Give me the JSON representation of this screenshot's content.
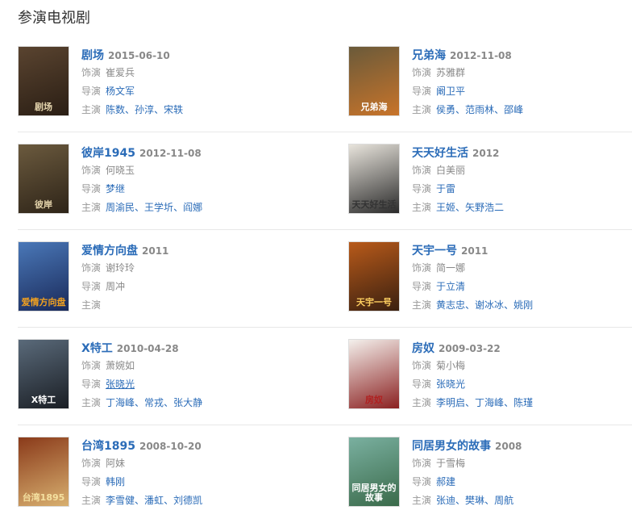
{
  "section": {
    "title": "参演电视剧"
  },
  "labels": {
    "role": "饰演",
    "director": "导演",
    "cast": "主演"
  },
  "colors": {
    "link": "#2b6cb8",
    "muted": "#888888",
    "divider": "#e8e8e8"
  },
  "dramas": [
    {
      "title": "剧场",
      "year": "2015-06-10",
      "role": "崔爱兵",
      "director": "杨文军",
      "director_link": true,
      "cast": [
        "陈数",
        "孙淳",
        "宋轶"
      ],
      "poster": {
        "colors": [
          "#5a4430",
          "#2a1e14"
        ],
        "text": "剧场",
        "text_color": "#e8d8b0"
      }
    },
    {
      "title": "兄弟海",
      "year": "2012-11-08",
      "role": "苏雅群",
      "director": "阚卫平",
      "director_link": true,
      "cast": [
        "侯勇",
        "范雨林",
        "邵峰"
      ],
      "poster": {
        "colors": [
          "#6a5a3a",
          "#c8742a"
        ],
        "text": "兄弟海",
        "text_color": "#ffffff"
      }
    },
    {
      "title": "彼岸1945",
      "year": "2012-11-08",
      "role": "何晓玉",
      "director": "梦继",
      "director_link": true,
      "cast": [
        "周渝民",
        "王学圻",
        "阎娜"
      ],
      "poster": {
        "colors": [
          "#6b5a3e",
          "#2e2418"
        ],
        "text": "彼岸",
        "text_color": "#e0d0a8"
      }
    },
    {
      "title": "天天好生活",
      "year": "2012",
      "role": "白美丽",
      "director": "于雷",
      "director_link": true,
      "cast": [
        "王姬",
        "矢野浩二"
      ],
      "poster": {
        "colors": [
          "#e8e4dc",
          "#2a2a2a"
        ],
        "text": "天天好生活",
        "text_color": "#333333"
      }
    },
    {
      "title": "爱情方向盘",
      "year": "2011",
      "role": "谢玲玲",
      "director": "周冲",
      "director_link": false,
      "cast": [],
      "poster": {
        "colors": [
          "#4a78b8",
          "#1a2a5a"
        ],
        "text": "爱情方向盘",
        "text_color": "#f0a020"
      }
    },
    {
      "title": "天宇一号",
      "year": "2011",
      "role": "简一娜",
      "director": "于立清",
      "director_link": true,
      "cast": [
        "黄志忠",
        "谢冰冰",
        "姚刚"
      ],
      "poster": {
        "colors": [
          "#b85a1a",
          "#3a2010"
        ],
        "text": "天宇一号",
        "text_color": "#ffd060"
      }
    },
    {
      "title": "X特工",
      "year": "2010-04-28",
      "role": "萧婉如",
      "director": "张晓光",
      "director_link": true,
      "director_underline": true,
      "cast": [
        "丁海峰",
        "常戎",
        "张大静"
      ],
      "poster": {
        "colors": [
          "#5a6a7a",
          "#1a1e24"
        ],
        "text": "X特工",
        "text_color": "#ffffff"
      }
    },
    {
      "title": "房奴",
      "year": "2009-03-22",
      "role": "菊小梅",
      "director": "张晓光",
      "director_link": true,
      "cast": [
        "李明启",
        "丁海峰",
        "陈瑾"
      ],
      "poster": {
        "colors": [
          "#f4f0ec",
          "#8a2020"
        ],
        "text": "房奴",
        "text_color": "#b02020"
      }
    },
    {
      "title": "台湾1895",
      "year": "2008-10-20",
      "role": "阿妹",
      "director": "韩刚",
      "director_link": true,
      "cast": [
        "李雪健",
        "潘虹",
        "刘德凯"
      ],
      "poster": {
        "colors": [
          "#8a3a1a",
          "#d8b070"
        ],
        "text": "台湾1895",
        "text_color": "#f4e0a0"
      }
    },
    {
      "title": "同居男女的故事",
      "year": "2008",
      "role": "于雪梅",
      "director": "郝建",
      "director_link": true,
      "cast": [
        "张迪",
        "樊琳",
        "周航"
      ],
      "poster": {
        "colors": [
          "#7ab0a0",
          "#3a6a4a"
        ],
        "text": "同居男女的故事",
        "text_color": "#ffffff"
      }
    }
  ]
}
